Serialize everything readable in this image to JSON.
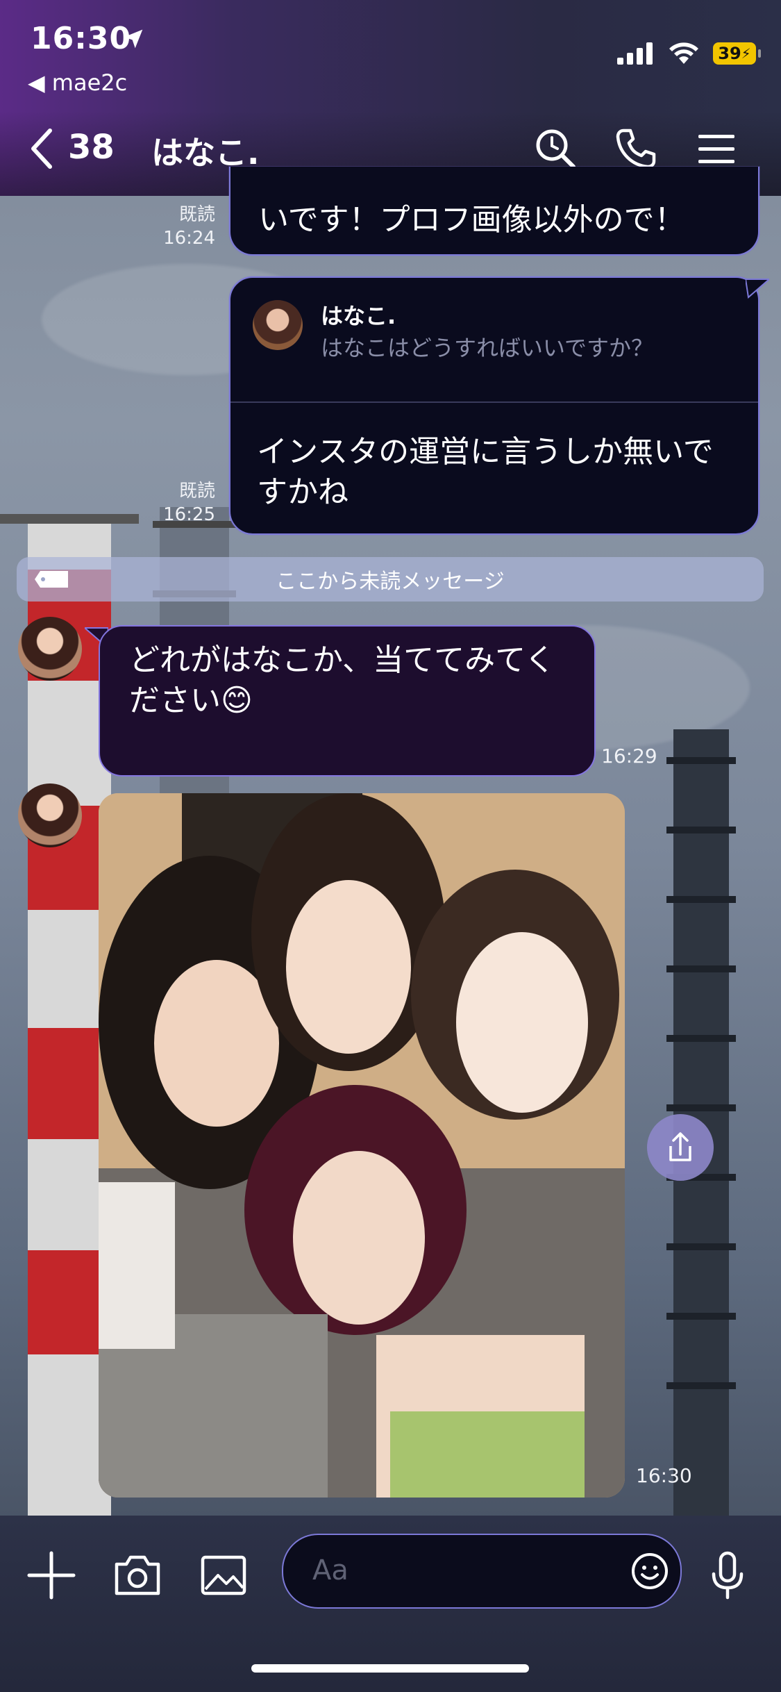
{
  "status_bar": {
    "time": "16:30",
    "back_app": "◀ mae2c",
    "battery": "39"
  },
  "header": {
    "unread_count": "38",
    "title": "はなこ."
  },
  "messages": [
    {
      "id": "m1",
      "direction": "outgoing",
      "text": "いです！プロフ画像以外ので！",
      "read_label": "既読",
      "time": "16:24"
    },
    {
      "id": "m2",
      "direction": "outgoing",
      "reply_to": {
        "name": "はなこ.",
        "text": "はなこはどうすればいいですか？"
      },
      "text": "インスタの運営に言うしか無いですかね",
      "read_label": "既読",
      "time": "16:25"
    },
    {
      "id": "divider",
      "text": "ここから未読メッセージ"
    },
    {
      "id": "m3",
      "direction": "incoming",
      "text": "どれがはなこか、当ててみてください😊",
      "time": "16:29"
    },
    {
      "id": "m4",
      "direction": "incoming",
      "type": "photo",
      "time": "16:30"
    }
  ],
  "input": {
    "placeholder": "Aa"
  },
  "icons": {
    "header": [
      "back-chevron-icon",
      "search-icon",
      "phone-icon",
      "menu-icon"
    ],
    "bottom": [
      "plus-icon",
      "camera-icon",
      "image-icon",
      "emoji-icon",
      "microphone-icon"
    ]
  },
  "colors": {
    "bubble_outgoing": "#0a0b1e",
    "bubble_incoming": "#1d0d2e",
    "bubble_border": "#7c79d8",
    "header_gradient_start": "#5b2b87"
  }
}
